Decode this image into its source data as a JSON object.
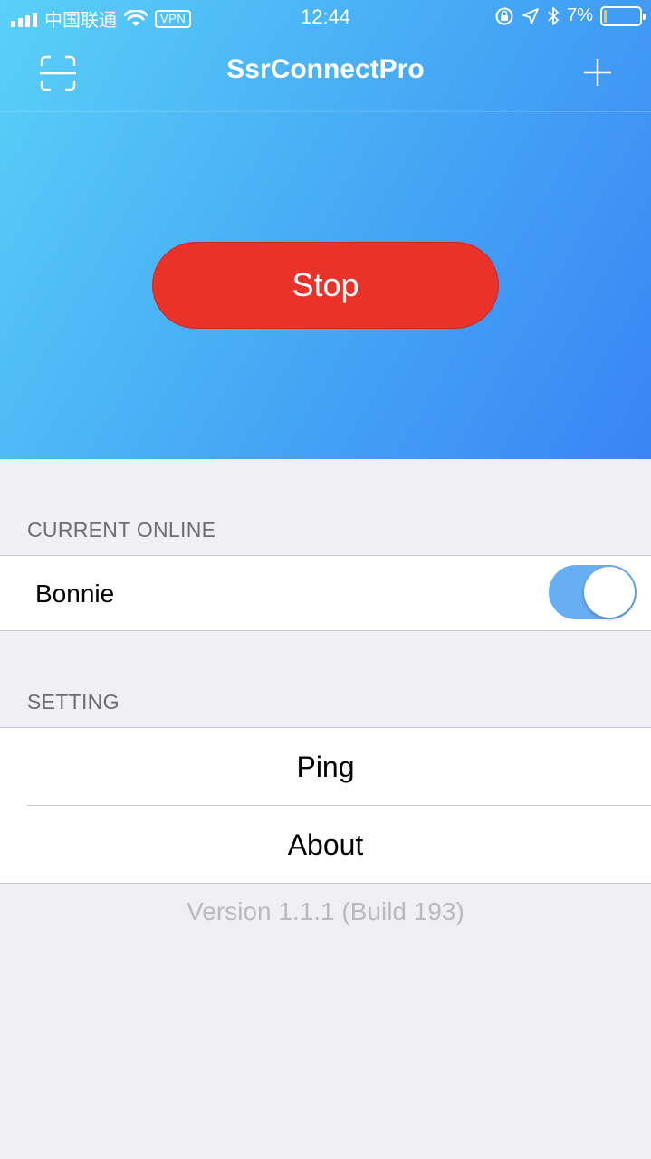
{
  "status_bar": {
    "carrier": "中国联通",
    "vpn": "VPN",
    "time": "12:44",
    "battery": "7%",
    "battery_level": 0.07
  },
  "nav": {
    "title": "SsrConnectPro",
    "left_icon": "scan-icon",
    "right_icon": "plus-icon"
  },
  "hero": {
    "button_label": "Stop",
    "button_color": "#e8322a"
  },
  "current_online": {
    "header": "CURRENT ONLINE",
    "server_name": "Bonnie",
    "toggle_on": true
  },
  "settings": {
    "header": "SETTING",
    "items": [
      {
        "label": "Ping"
      },
      {
        "label": "About"
      }
    ]
  },
  "version": "Version 1.1.1 (Build 193)"
}
